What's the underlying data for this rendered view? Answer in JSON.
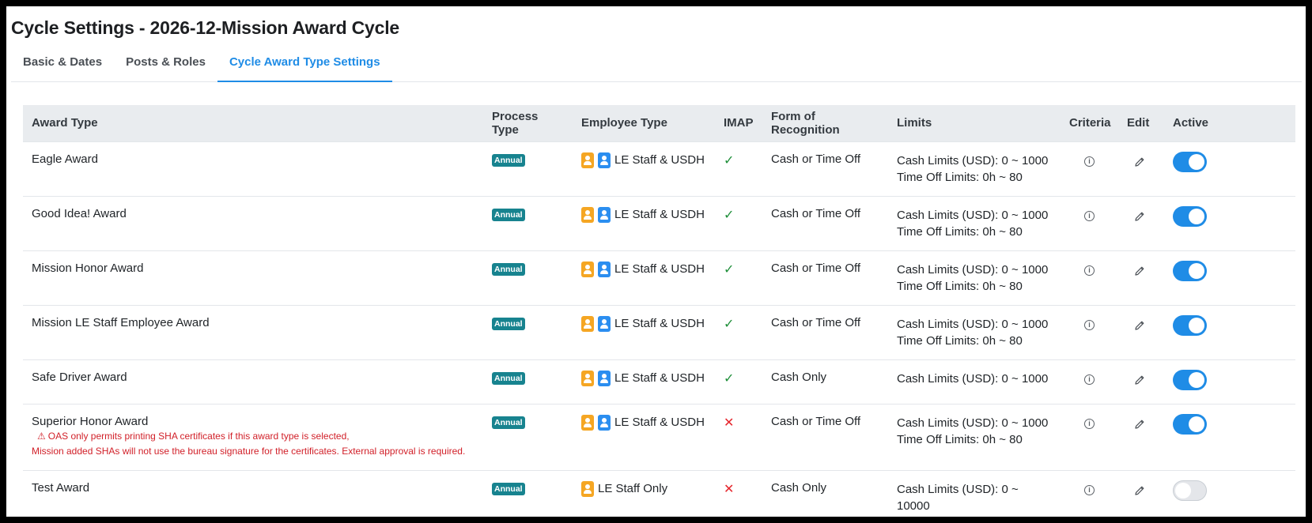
{
  "page": {
    "title": "Cycle Settings - 2026-12-Mission Award Cycle"
  },
  "tabs": [
    {
      "label": "Basic & Dates"
    },
    {
      "label": "Posts & Roles"
    },
    {
      "label": "Cycle Award Type Settings"
    }
  ],
  "table": {
    "headers": {
      "award_type": "Award Type",
      "process_type": "Process Type",
      "employee_type": "Employee Type",
      "imap": "IMAP",
      "form": "Form of Recognition",
      "limits": "Limits",
      "criteria": "Criteria",
      "edit": "Edit",
      "active": "Active"
    },
    "rows": [
      {
        "award": "Eagle Award",
        "process": "Annual",
        "employee": "LE Staff & USDH",
        "imap": "✓",
        "form": "Cash or Time Off",
        "cash": "Cash Limits (USD): 0 ~ 1000",
        "time": "Time Off Limits: 0h ~ 80",
        "active": true
      },
      {
        "award": "Good Idea! Award",
        "process": "Annual",
        "employee": "LE Staff & USDH",
        "imap": "✓",
        "form": "Cash or Time Off",
        "cash": "Cash Limits (USD): 0 ~ 1000",
        "time": "Time Off Limits: 0h ~ 80",
        "active": true
      },
      {
        "award": "Mission Honor Award",
        "process": "Annual",
        "employee": "LE Staff & USDH",
        "imap": "✓",
        "form": "Cash or Time Off",
        "cash": "Cash Limits (USD): 0 ~ 1000",
        "time": "Time Off Limits: 0h ~ 80",
        "active": true
      },
      {
        "award": "Mission LE Staff Employee Award",
        "process": "Annual",
        "employee": "LE Staff & USDH",
        "imap": "✓",
        "form": "Cash or Time Off",
        "cash": "Cash Limits (USD): 0 ~ 1000",
        "time": "Time Off Limits: 0h ~ 80",
        "active": true
      },
      {
        "award": "Safe Driver Award",
        "process": "Annual",
        "employee": "LE Staff & USDH",
        "imap": "✓",
        "form": "Cash Only",
        "cash": "Cash Limits (USD): 0 ~ 1000",
        "active": true
      },
      {
        "award": "Superior Honor Award",
        "process": "Annual",
        "employee": "LE Staff & USDH",
        "imap": "✕",
        "form": "Cash or Time Off",
        "cash": "Cash Limits (USD): 0 ~ 1000",
        "time": "Time Off Limits: 0h ~ 80",
        "active": true,
        "warning_line1": "OAS only permits printing SHA certificates if this award type is selected,",
        "warning_line2": "Mission added SHAs will not use the bureau signature for the certificates. External approval is required."
      },
      {
        "award": "Test Award",
        "process": "Annual",
        "employee": "LE Staff Only",
        "imap": "✕",
        "form": "Cash Only",
        "cash": "Cash Limits (USD): 0 ~ 10000",
        "active": false
      }
    ]
  },
  "icons": {
    "warning": "⚠",
    "info": "i"
  },
  "colors": {
    "accent": "#1f8ce6",
    "badge": "#17838f",
    "check": "#1f8f3a",
    "cross": "#e5262d",
    "warning_text": "#d11f28",
    "le_staff_icon": "#f5a623",
    "usdh_icon": "#2b8ef0"
  }
}
